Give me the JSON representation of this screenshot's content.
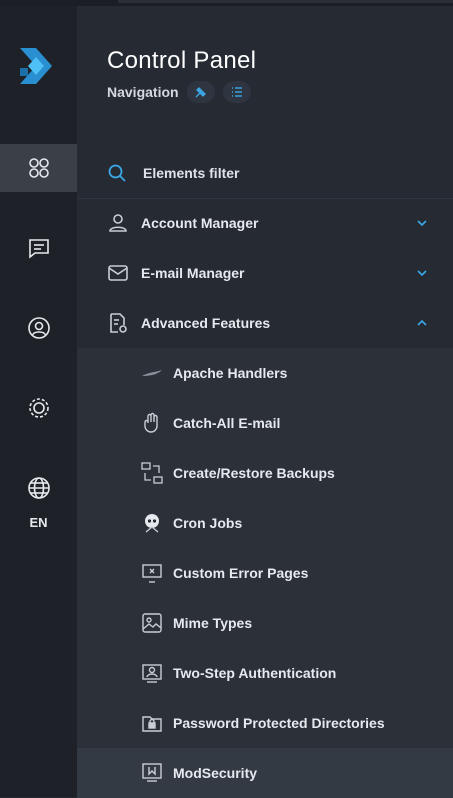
{
  "app": {
    "title": "Control Panel",
    "subtitle": "Navigation"
  },
  "rail": {
    "language": "EN"
  },
  "filter": {
    "placeholder": "Elements filter"
  },
  "sections": {
    "account": {
      "label": "Account Manager"
    },
    "email": {
      "label": "E-mail Manager"
    },
    "advanced": {
      "label": "Advanced Features"
    }
  },
  "advanced_items": [
    {
      "label": "Apache Handlers"
    },
    {
      "label": "Catch-All E-mail"
    },
    {
      "label": "Create/Restore Backups"
    },
    {
      "label": "Cron Jobs"
    },
    {
      "label": "Custom Error Pages"
    },
    {
      "label": "Mime Types"
    },
    {
      "label": "Two-Step Authentication"
    },
    {
      "label": "Password Protected Directories"
    },
    {
      "label": "ModSecurity"
    }
  ],
  "colors": {
    "accent": "#3ba8e8",
    "rail_bg": "#1e2228",
    "panel_bg": "#252a33",
    "submenu_bg": "#2b3039"
  }
}
